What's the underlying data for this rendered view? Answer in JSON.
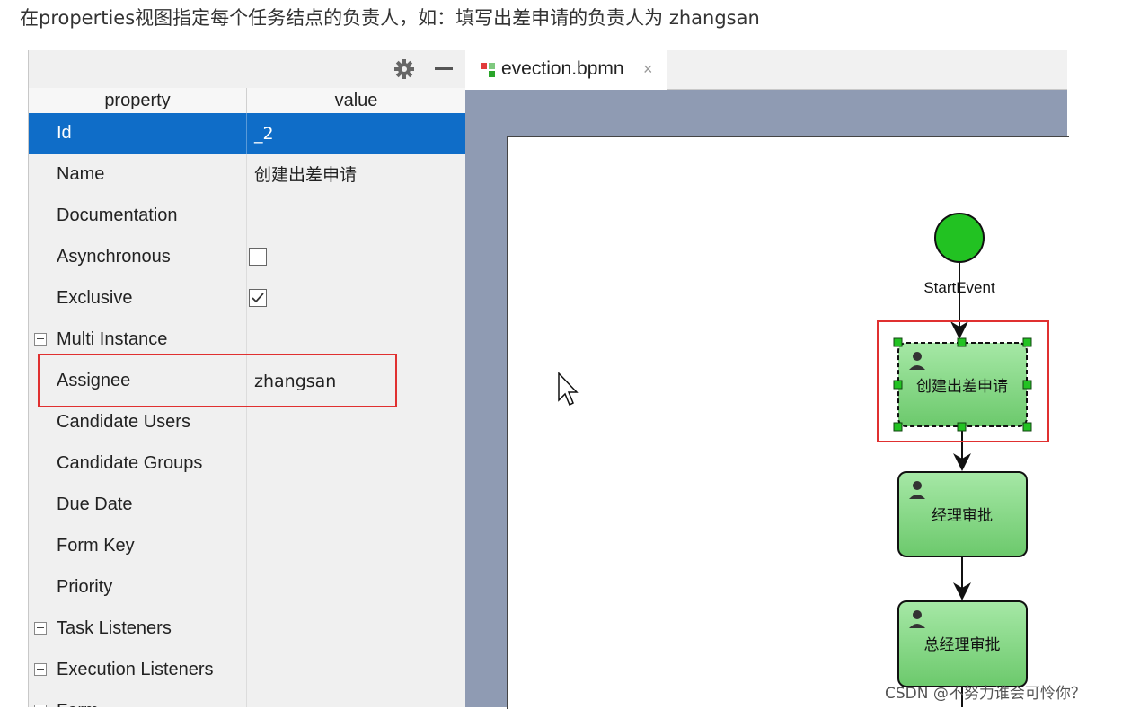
{
  "caption": "在properties视图指定每个任务结点的负责人，如：填写出差申请的负责人为 zhangsan",
  "properties": {
    "headers": {
      "property": "property",
      "value": "value"
    },
    "rows": [
      {
        "name": "Id",
        "value": "_2",
        "selected": true
      },
      {
        "name": "Name",
        "value": "创建出差申请"
      },
      {
        "name": "Documentation",
        "value": ""
      },
      {
        "name": "Asynchronous",
        "checkbox": false
      },
      {
        "name": "Exclusive",
        "checkbox": true
      },
      {
        "name": "Multi Instance",
        "value": "",
        "expandable": true
      },
      {
        "name": "Assignee",
        "value": "zhangsan",
        "highlighted": true
      },
      {
        "name": "Candidate Users",
        "value": ""
      },
      {
        "name": "Candidate Groups",
        "value": ""
      },
      {
        "name": "Due Date",
        "value": ""
      },
      {
        "name": "Form Key",
        "value": ""
      },
      {
        "name": "Priority",
        "value": ""
      },
      {
        "name": "Task Listeners",
        "value": "",
        "expandable": true
      },
      {
        "name": "Execution Listeners",
        "value": "",
        "expandable": true
      },
      {
        "name": "Form",
        "value": "",
        "expandable": true
      }
    ]
  },
  "editor": {
    "tab_label": "evection.bpmn",
    "tab_close": "×"
  },
  "diagram": {
    "start_label": "StartEvent",
    "tasks": [
      {
        "label": "创建出差申请",
        "selected": true
      },
      {
        "label": "经理审批"
      },
      {
        "label": "总经理审批"
      }
    ]
  },
  "watermark": "CSDN @不努力谁会可怜你？",
  "colors": {
    "selection": "#0f6dc8",
    "highlight": "#e03030",
    "task_fill": "#7fd67f",
    "start_fill": "#22c222"
  }
}
